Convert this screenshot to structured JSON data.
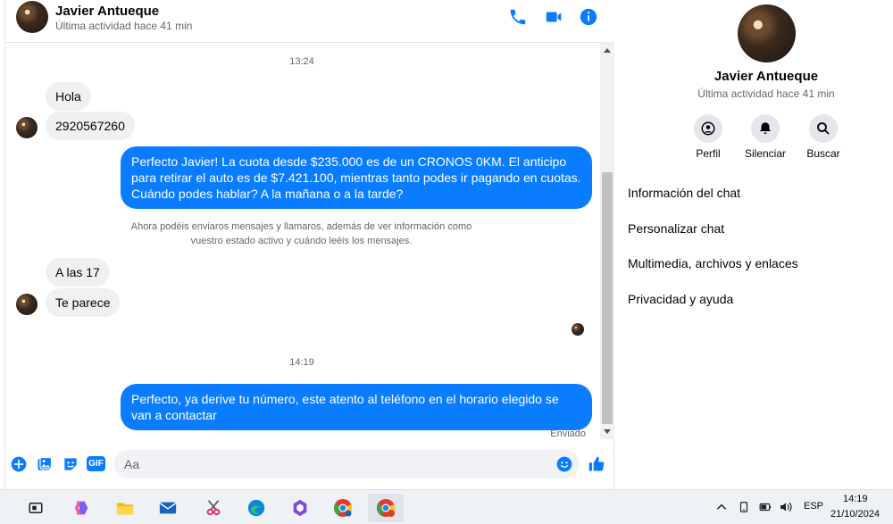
{
  "contact": {
    "name": "Javier Antueque",
    "status": "Última actividad hace 41 min"
  },
  "header_icons": [
    "phone-icon",
    "video-icon",
    "info-icon"
  ],
  "messages": {
    "timestamp1": "13:24",
    "in1": "Hola",
    "in2": "2920567260",
    "out1": "Perfecto Javier!  La cuota desde $235.000 es de un CRONOS 0KM. El anticipo para retirar el auto es de $7.421.100, mientras tanto podes ir pagando en cuotas. Cuándo podes hablar? A la mañana o a la tarde?",
    "notice": "Ahora podéis enviaros mensajes y llamaros, además de ver información como vuestro estado activo y cuándo leéis los mensajes.",
    "in3": "A las 17",
    "in4": "Te parece",
    "timestamp2": "14:19",
    "out2": "Perfecto, ya derive tu número, este atento al teléfono en el horario elegido se van a contactar",
    "sent": "Enviado"
  },
  "composer": {
    "placeholder": "Aa",
    "gif_label": "GIF"
  },
  "info_panel": {
    "actions": {
      "profile": "Perfil",
      "mute": "Silenciar",
      "search": "Buscar"
    },
    "menu": {
      "chat_info": "Información del chat",
      "customize": "Personalizar chat",
      "media": "Multimedia, archivos y enlaces",
      "privacy": "Privacidad y ayuda"
    }
  },
  "taskbar": {
    "language": "ESP",
    "time": "14:19",
    "date": "21/10/2024"
  },
  "colors": {
    "accent": "#0a7cff",
    "incoming_bubble": "#f0f0f0",
    "secondary_text": "#65676b"
  }
}
